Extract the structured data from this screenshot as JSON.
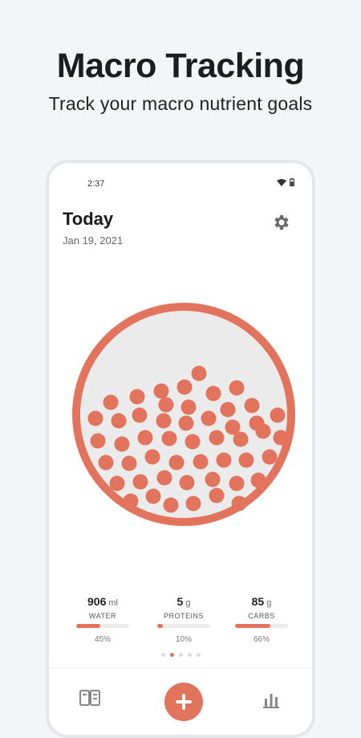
{
  "promo": {
    "title": "Macro Tracking",
    "subtitle": "Track your macro nutrient goals"
  },
  "status_bar": {
    "time": "2:37",
    "icons": [
      "wifi-icon",
      "battery-icon"
    ]
  },
  "header": {
    "title": "Today",
    "date": "Jan 19, 2021",
    "settings_icon": "gear-icon"
  },
  "macros": [
    {
      "value": "906",
      "unit": "ml",
      "label": "WATER",
      "percent_text": "45%",
      "progress": 0.45
    },
    {
      "value": "5",
      "unit": "g",
      "label": "PROTEINS",
      "percent_text": "10%",
      "progress": 0.1
    },
    {
      "value": "85",
      "unit": "g",
      "label": "CARBS",
      "percent_text": "66%",
      "progress": 0.66
    }
  ],
  "pager": {
    "pages": 5,
    "active": 1
  },
  "tab_bar": {
    "left_icon": "book-icon",
    "center_icon": "plus-icon",
    "right_icon": "bar-chart-icon"
  },
  "colors": {
    "accent": "#e2745d",
    "bowl_fill": "#ebebeb",
    "text_dark": "#1a1a1a"
  }
}
